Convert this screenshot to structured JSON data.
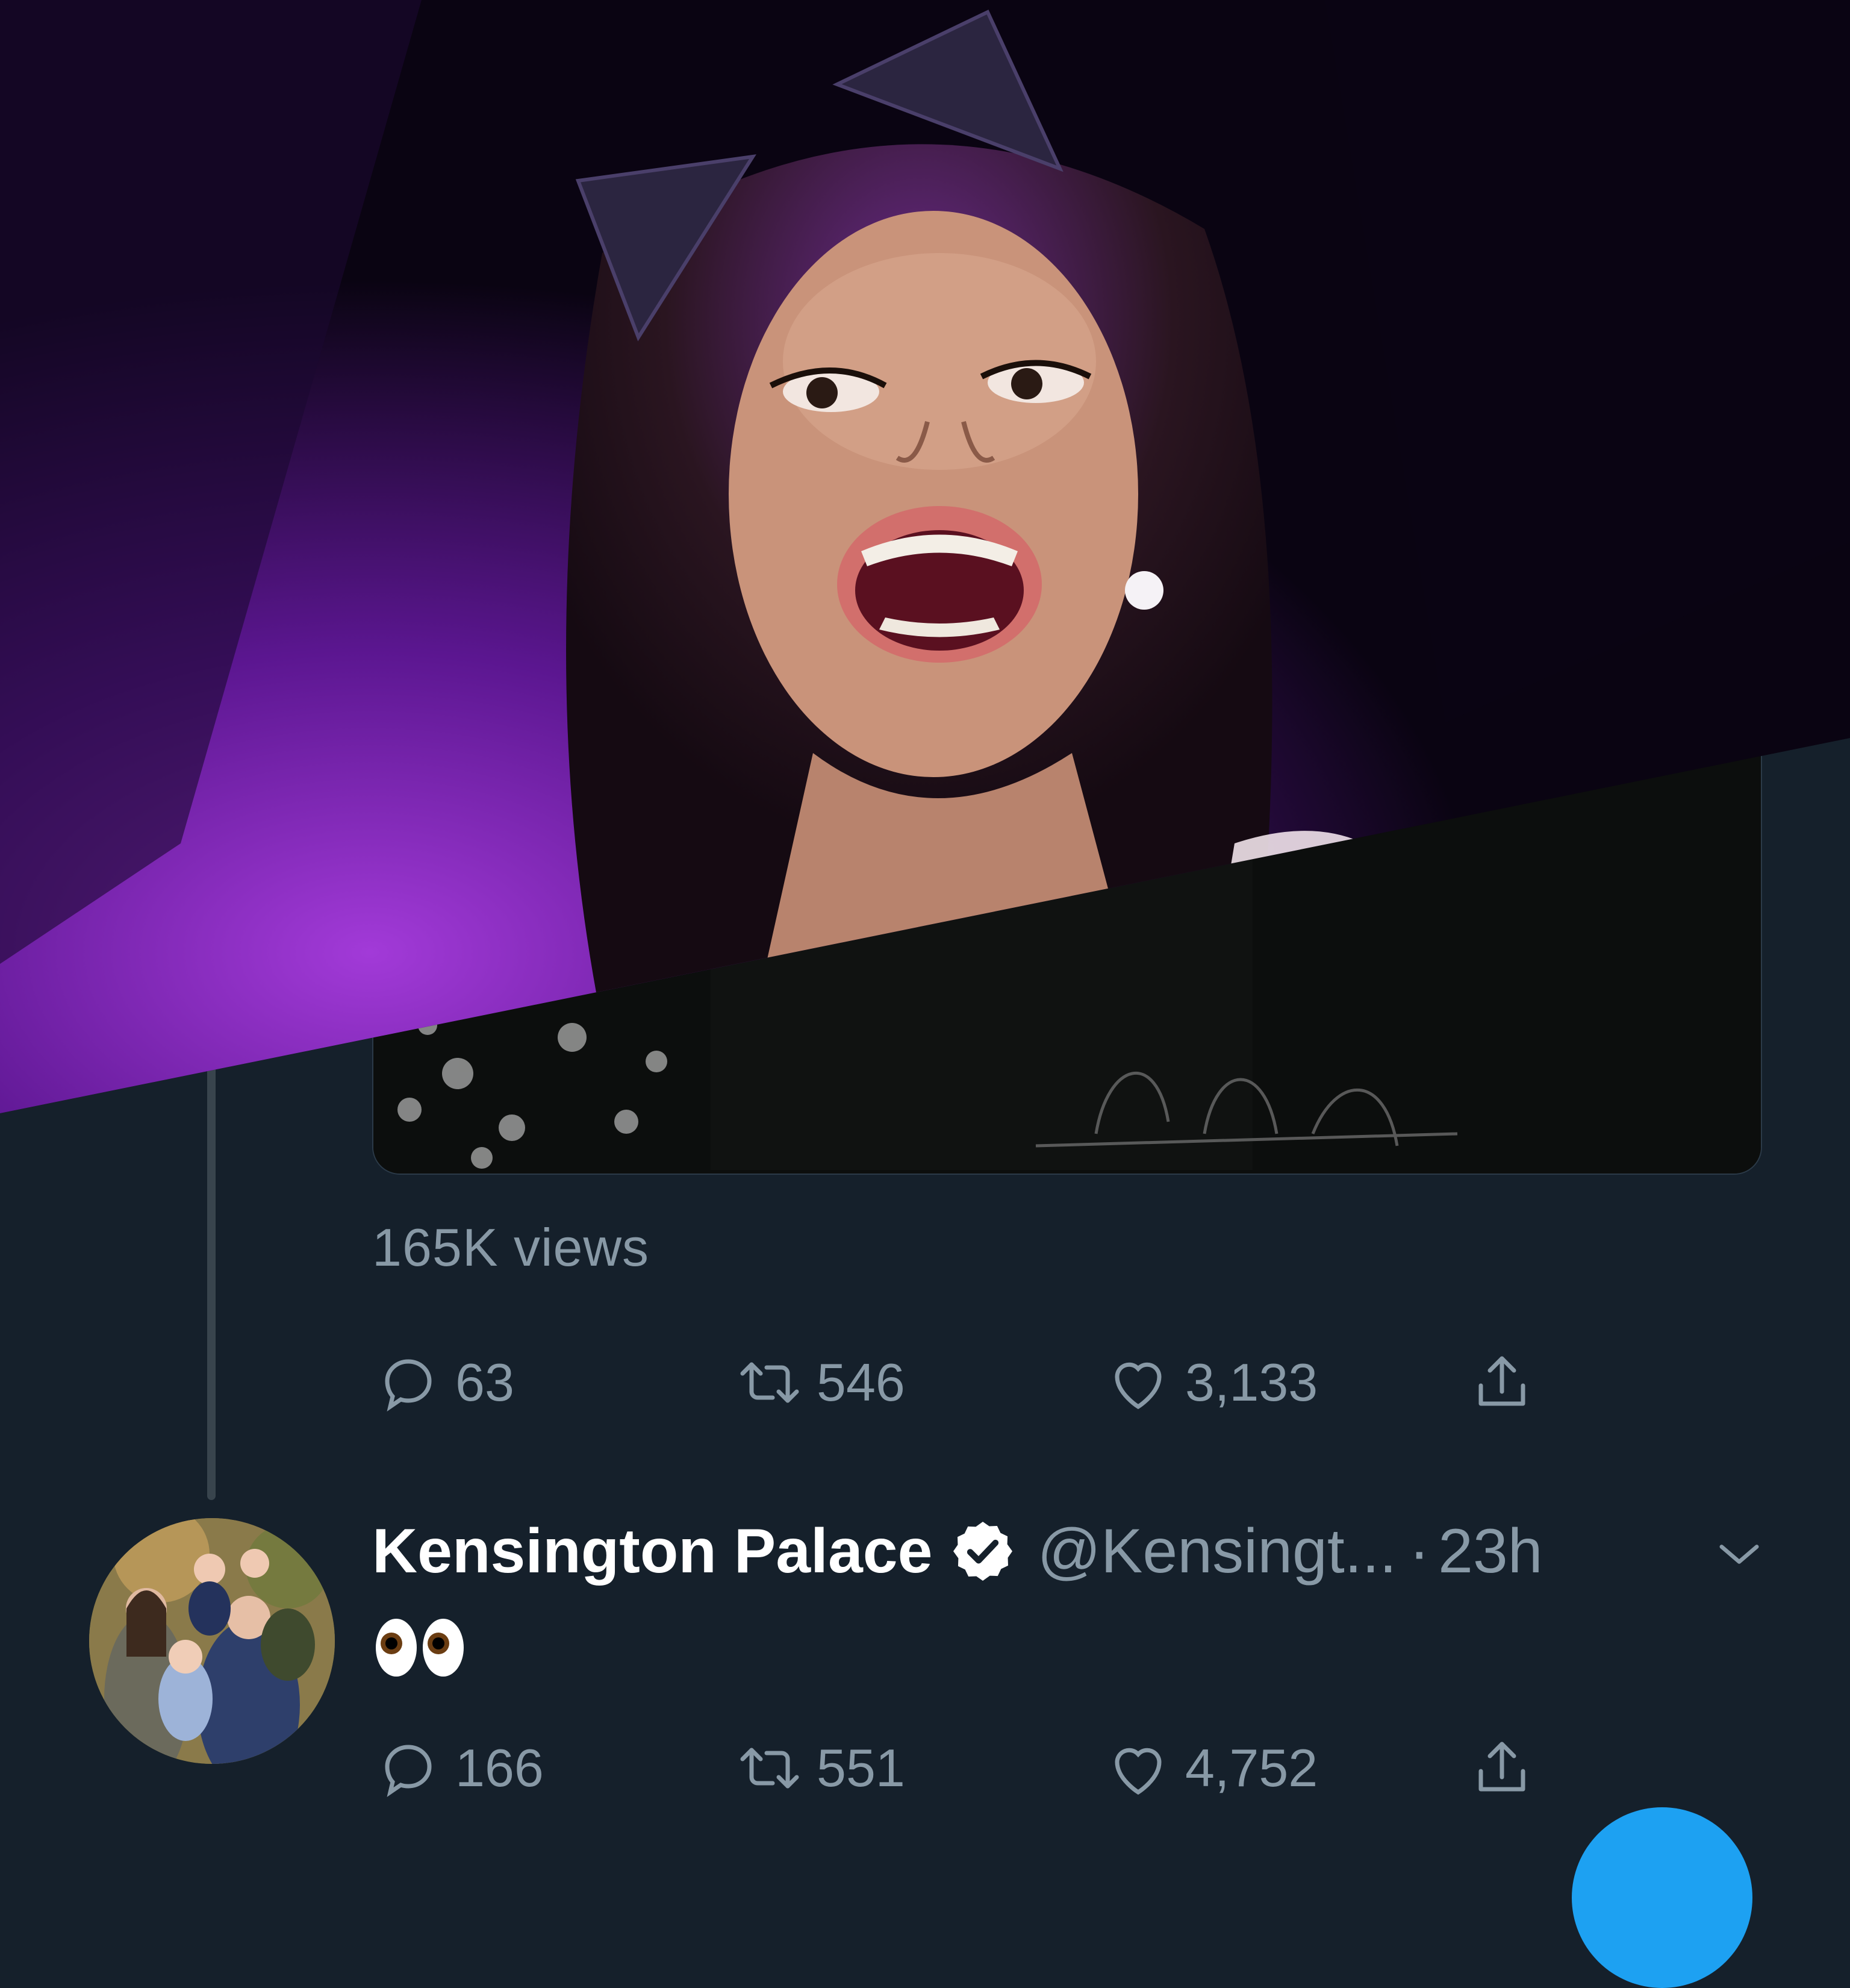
{
  "tweet1": {
    "views_label": "165K views",
    "actions": {
      "reply": {
        "icon": "reply-icon",
        "count": "63"
      },
      "retweet": {
        "icon": "retweet-icon",
        "count": "546"
      },
      "like": {
        "icon": "heart-icon",
        "count": "3,133"
      },
      "share": {
        "icon": "share-icon"
      }
    }
  },
  "tweet2": {
    "author_name": "Kensington Palace",
    "verified": true,
    "handle": "@Kensingt...",
    "separator": "·",
    "time": "23h",
    "text": "👀",
    "actions": {
      "reply": {
        "icon": "reply-icon",
        "count": "166"
      },
      "retweet": {
        "icon": "retweet-icon",
        "count": "551"
      },
      "like": {
        "icon": "heart-icon",
        "count": "4,752"
      },
      "share": {
        "icon": "share-icon"
      }
    }
  },
  "colors": {
    "background": "#15202b",
    "secondary_text": "#8899a6",
    "primary_text": "#ffffff",
    "accent": "#1da1f2",
    "thread_line": "#38444d"
  }
}
